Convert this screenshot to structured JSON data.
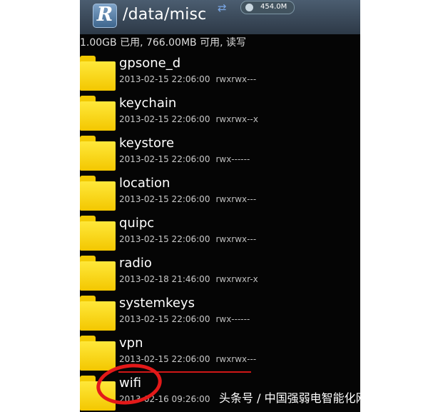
{
  "window": {
    "title": "/data/misc",
    "app_icon_letter": "R",
    "status_storage": "454.0M"
  },
  "storage_info": "1.00GB 已用, 766.00MB 可用, 读写",
  "folders": [
    {
      "name": "gpsone_d",
      "date": "2013-02-15 22:06:00",
      "permissions": "rwxrwx---"
    },
    {
      "name": "keychain",
      "date": "2013-02-15 22:06:00",
      "permissions": "rwxrwx--x"
    },
    {
      "name": "keystore",
      "date": "2013-02-15 22:06:00",
      "permissions": "rwx------"
    },
    {
      "name": "location",
      "date": "2013-02-15 22:06:00",
      "permissions": "rwxrwx---"
    },
    {
      "name": "quipc",
      "date": "2013-02-15 22:06:00",
      "permissions": "rwxrwx---"
    },
    {
      "name": "radio",
      "date": "2013-02-18 21:46:00",
      "permissions": "rwxrwxr-x"
    },
    {
      "name": "systemkeys",
      "date": "2013-02-15 22:06:00",
      "permissions": "rwx------"
    },
    {
      "name": "vpn",
      "date": "2013-02-15 22:06:00",
      "permissions": "rwxrwx---"
    },
    {
      "name": "wifi",
      "date": "2013-02-16 09:26:00",
      "permissions": ""
    }
  ],
  "watermark": "头条号 / 中国强弱电智能化网",
  "colors": {
    "folder": "#f3c700",
    "highlight": "#e31919",
    "background": "#050505"
  }
}
